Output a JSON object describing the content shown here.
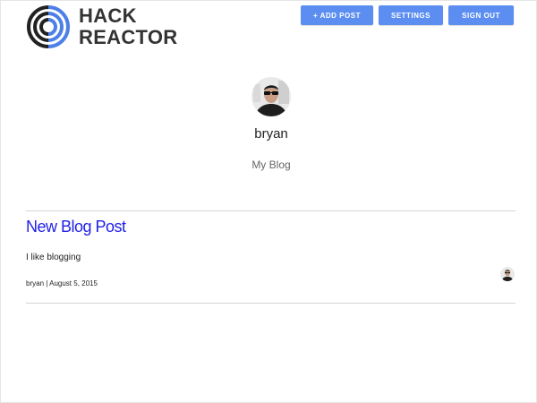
{
  "brand": {
    "line1": "HACK",
    "line2": "REACTOR",
    "accent": "#4d7fe8",
    "dark": "#222222"
  },
  "nav": {
    "add_post": "+ ADD POST",
    "settings": "SETTINGS",
    "sign_out": "SIGN OUT",
    "button_color": "#5b8ef0"
  },
  "profile": {
    "username": "bryan",
    "blog_name": "My Blog"
  },
  "posts": [
    {
      "title": "New Blog Post",
      "body": "I like blogging",
      "author": "bryan",
      "date": "August 5, 2015",
      "title_color": "#1f1fe8"
    }
  ]
}
